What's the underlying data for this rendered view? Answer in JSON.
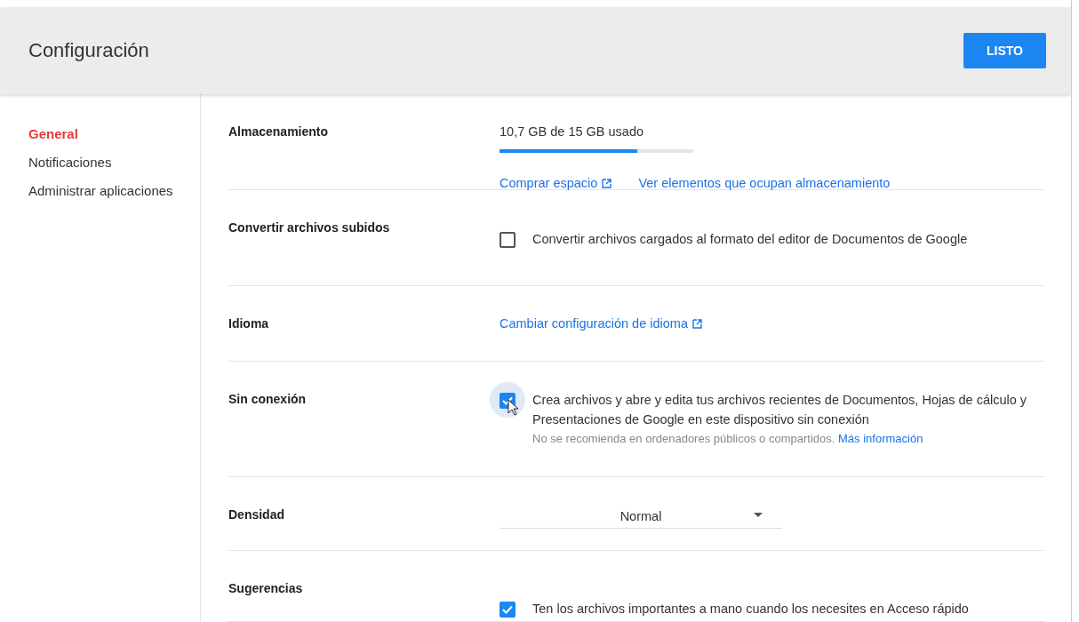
{
  "header": {
    "title": "Configuración",
    "done_button": "LISTO"
  },
  "sidebar": {
    "items": [
      {
        "label": "General",
        "selected": true
      },
      {
        "label": "Notificaciones",
        "selected": false
      },
      {
        "label": "Administrar aplicaciones",
        "selected": false
      }
    ]
  },
  "settings": [
    {
      "kind": "storage",
      "label": "Almacenamiento",
      "usage": "10,7 GB de 15 GB usado",
      "level": 0.71,
      "links": [
        {
          "text": "Comprar espacio",
          "external": true
        },
        {
          "text": "Ver elementos que ocupan almacenamiento",
          "external": false
        }
      ]
    },
    {
      "kind": "checkbox",
      "label": "Convertir archivos subidos",
      "text": "Convertir archivos cargados al formato del editor de Documentos de Google",
      "checked": false,
      "hovered": false
    },
    {
      "kind": "link",
      "label": "Idioma",
      "links": [
        {
          "text": "Cambiar configuración de idioma",
          "external": true
        }
      ]
    },
    {
      "kind": "checkbox",
      "label": "Sin conexión",
      "text": "Crea archivos y abre y edita tus archivos recientes de Documentos, Hojas de cálculo y Presentaciones de Google en este dispositivo sin conexión",
      "note": "No se recomienda en ordenadores públicos o compartidos.",
      "note_link": "Más información",
      "checked": true,
      "hovered": true
    },
    {
      "kind": "select",
      "label": "Densidad",
      "value": "Normal"
    },
    {
      "kind": "checkbox",
      "label": "Sugerencias",
      "text": "Ten los archivos importantes a mano cuando los necesites en Acceso rápido",
      "checked": true,
      "hovered": false
    }
  ]
}
